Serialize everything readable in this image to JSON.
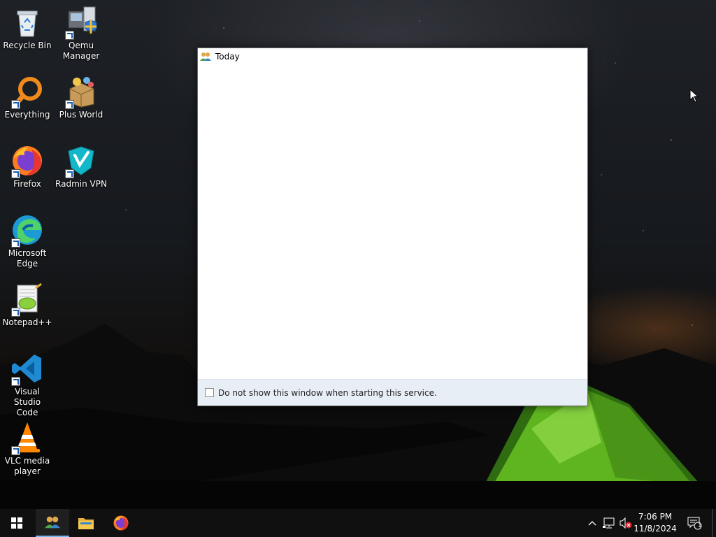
{
  "desktop": {
    "icons": [
      {
        "label": "Recycle Bin",
        "icon": "recycle-bin-icon"
      },
      {
        "label": "Qemu\nManager",
        "icon": "qemu-manager-icon"
      },
      {
        "label": "Everything",
        "icon": "everything-search-icon"
      },
      {
        "label": "Plus World",
        "icon": "plus-world-icon"
      },
      {
        "label": "Firefox",
        "icon": "firefox-icon"
      },
      {
        "label": "Radmin VPN",
        "icon": "radmin-vpn-icon"
      },
      {
        "label": "Microsoft\nEdge",
        "icon": "edge-icon"
      },
      {
        "label": "Notepad++",
        "icon": "notepad-plus-plus-icon"
      },
      {
        "label": "Visual Studio\nCode",
        "icon": "vscode-icon"
      },
      {
        "label": "VLC media\nplayer",
        "icon": "vlc-icon"
      }
    ]
  },
  "window": {
    "title": "Today",
    "icon": "people-icon",
    "footer_checkbox_label": "Do not show this window when starting this service.",
    "footer_checkbox_checked": false
  },
  "taskbar": {
    "start_icon": "windows-logo-icon",
    "pinned": [
      {
        "name": "people-app",
        "icon": "people-icon",
        "active": true
      },
      {
        "name": "file-explorer",
        "icon": "folder-icon",
        "active": false
      },
      {
        "name": "firefox",
        "icon": "firefox-icon",
        "active": false
      }
    ],
    "tray_icons": [
      "chevron-up-icon",
      "network-icon",
      "volume-muted-icon"
    ],
    "time": "7:06 PM",
    "date": "11/8/2024",
    "notification_count": "1"
  },
  "colors": {
    "taskbar_bg": "#101010",
    "accent": "#76b9ed",
    "window_footer_bg": "#e8eef6"
  }
}
